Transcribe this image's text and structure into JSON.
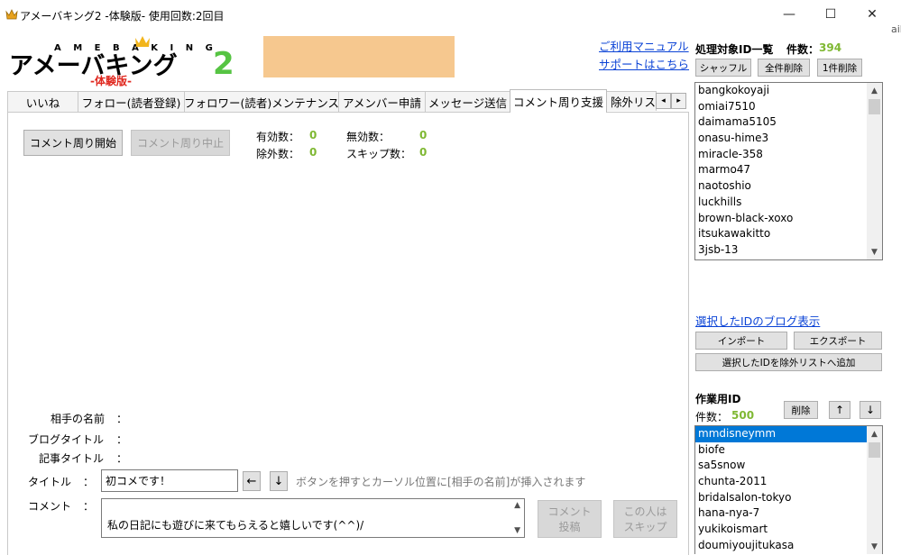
{
  "window": {
    "title": "アメーバキング2 -体験版- 使用回数:2回目",
    "minimize": "—",
    "maximize": "☐",
    "close": "✕"
  },
  "logo": {
    "top_text": "A M E B A K I N G",
    "main_text": "アメーバキング",
    "number": "2",
    "trial": "-体験版-"
  },
  "links": {
    "manual": "ご利用マニュアル",
    "support": "サポートはこちら"
  },
  "tabs": [
    {
      "label": "いいね"
    },
    {
      "label": "フォロー(読者登録)"
    },
    {
      "label": "フォロワー(読者)メンテナンス"
    },
    {
      "label": "アメンバー申請"
    },
    {
      "label": "メッセージ送信"
    },
    {
      "label": "コメント周り支援"
    },
    {
      "label": "除外リス"
    }
  ],
  "tab_scroll": {
    "left": "◂",
    "right": "▸"
  },
  "controls": {
    "start": "コメント周り開始",
    "stop": "コメント周り中止"
  },
  "stats": {
    "valid_label": "有効数：",
    "valid_value": "0",
    "invalid_label": "無効数：",
    "invalid_value": "0",
    "excluded_label": "除外数：",
    "excluded_value": "0",
    "skip_label": "スキップ数：",
    "skip_value": "0"
  },
  "info": {
    "partner_name_label": "相手の名前",
    "blog_title_label": "ブログタイトル",
    "article_title_label": "記事タイトル",
    "colon": "："
  },
  "title_field": {
    "label": "タイトル",
    "colon": "：",
    "value": "初コメです！",
    "left_arrow": "←",
    "down_arrow": "↓",
    "hint": "ボタンを押すとカーソル位置に[相手の名前]が挿入されます"
  },
  "comment_field": {
    "label": "コメント",
    "colon": "：",
    "value": "私の日記にも遊びに来てもらえると嬉しいです(^^)/",
    "post_line1": "コメント",
    "post_line2": "投稿",
    "skip_line1": "この人は",
    "skip_line2": "スキップ"
  },
  "target_ids": {
    "title": "処理対象ID一覧",
    "count_label": "件数：",
    "count_value": "394",
    "shuffle": "シャッフル",
    "delete_all": "全件削除",
    "delete_one": "1件削除",
    "items": [
      "bangkokoyaji",
      "omiai7510",
      "daimama5105",
      "onasu-hime3",
      "miracle-358",
      "marmo47",
      "naotoshio",
      "luckhills",
      "brown-black-xoxo",
      "itsukawakitto",
      "3jsb-13"
    ],
    "show_blog_link": "選択したIDのブログ表示",
    "import": "インポート",
    "export": "エクスポート",
    "add_exclude": "選択したIDを除外リストへ追加"
  },
  "work_ids": {
    "title": "作業用ID",
    "count_label": "件数：",
    "count_value": "500",
    "delete": "削除",
    "up": "↑",
    "down": "↓",
    "items": [
      "mmdisneymm",
      "biofe",
      "sa5snow",
      "chunta-2011",
      "bridalsalon-tokyo",
      "hana-nya-7",
      "yukikoismart",
      "doumiyoujitukasa"
    ]
  },
  "scroll": {
    "up": "▲",
    "down": "▼"
  },
  "clip_text": "ail"
}
